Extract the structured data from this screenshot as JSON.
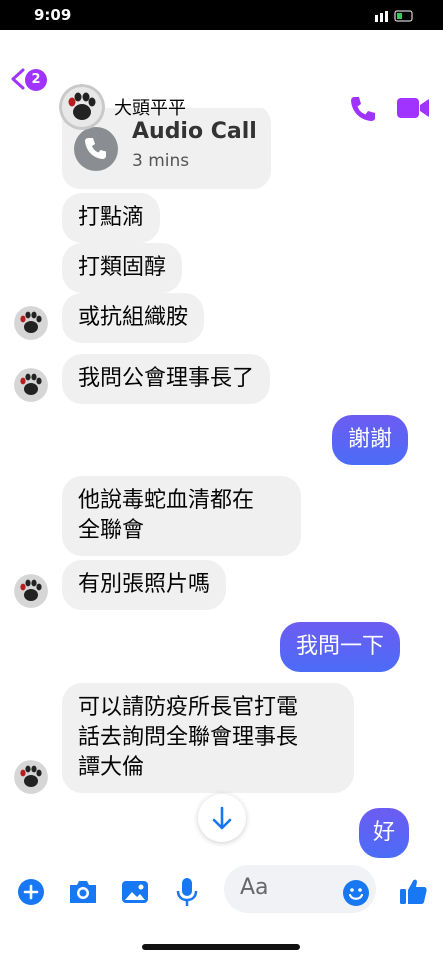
{
  "status_bar": {
    "time": "9:09"
  },
  "header": {
    "name": "大頭平平",
    "back_badge": "2"
  },
  "audio_call": {
    "title": "Audio Call",
    "duration": "3 mins"
  },
  "messages": [
    {
      "text": "打點滴"
    },
    {
      "text": "打類固醇"
    },
    {
      "text": "或抗組織胺"
    },
    {
      "text": "我問公會理事長了"
    },
    {
      "text": "謝謝"
    },
    {
      "text": "他說毒蛇血清都在"
    },
    {
      "text": "全聯會"
    },
    {
      "text": "有別張照片嗎"
    },
    {
      "text": "我問一下"
    },
    {
      "text": "可以請防疫所長官打電"
    },
    {
      "text": "話去詢問全聯會理事長"
    },
    {
      "text": "譚大倫"
    },
    {
      "text": "好"
    }
  ],
  "composer": {
    "placeholder": "Aa"
  },
  "colors": {
    "accent": "#a033ff",
    "outgoing": "#5b5ff5",
    "composer_icons": "#1877f2"
  }
}
